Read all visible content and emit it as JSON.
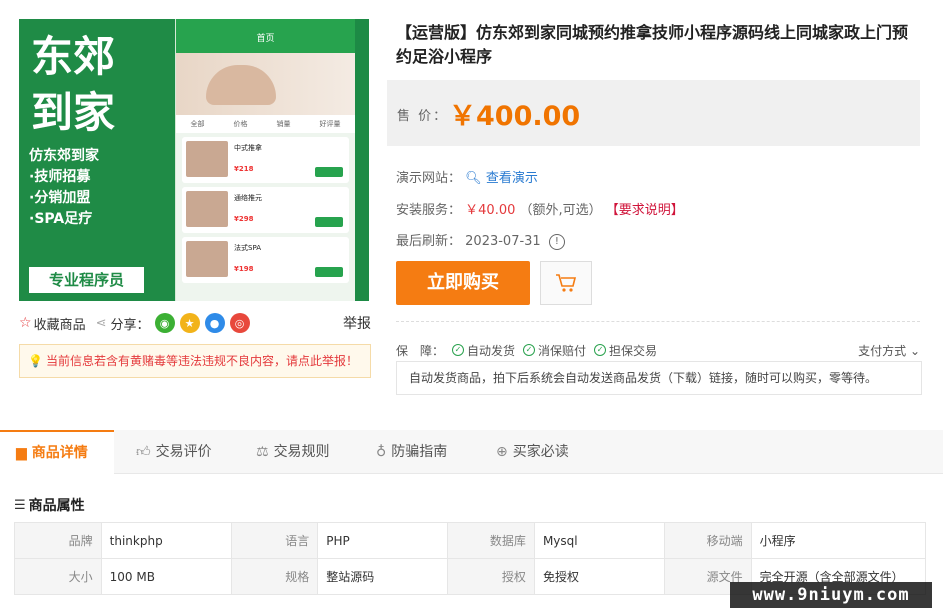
{
  "product_image": {
    "headline": "东郊\n到家",
    "bullets": [
      "仿东郊到家",
      "·技师招募",
      "·分销加盟",
      "·SPA足疗"
    ],
    "badge": "专业程序员",
    "phone": {
      "bar": "首页",
      "tabs": [
        "全部",
        "价格",
        "销量",
        "好评量"
      ],
      "items": [
        {
          "name": "中式推拿",
          "price": "¥218"
        },
        {
          "name": "通络推元",
          "price": "¥298"
        },
        {
          "name": "法式SPA",
          "price": "¥198"
        }
      ]
    }
  },
  "actions": {
    "favorite": "收藏商品",
    "share": "分享：",
    "report": "举报"
  },
  "notice": "当前信息若含有黄赌毒等违法违规不良内容，请点此举报！",
  "title": "【运营版】仿东郊到家同城预约推拿技师小程序源码线上同城家政上门预约足浴小程序",
  "price": {
    "label": "售 价：",
    "value": "￥400.00"
  },
  "demo": {
    "label": "演示网站：",
    "link": "查看演示"
  },
  "install": {
    "label": "安装服务：",
    "price": "￥40.00",
    "note": "（额外,可选）",
    "link": "【要求说明】"
  },
  "refresh": {
    "label": "最后刷新：",
    "date": "2023-07-31"
  },
  "buttons": {
    "buy": "立即购买"
  },
  "guarantee": {
    "label": "保　障：",
    "items": [
      "自动发货",
      "消保赔付",
      "担保交易"
    ],
    "pay": "支付方式",
    "desc": "自动发货商品，拍下后系统会自动发送商品发货（下载）链接，随时可以购买，零等待。"
  },
  "tabs": [
    "商品详情",
    "交易评价",
    "交易规则",
    "防骗指南",
    "买家必读"
  ],
  "attributes": {
    "heading": "商品属性",
    "rows": [
      [
        [
          "品牌",
          "thinkphp"
        ],
        [
          "语言",
          "PHP"
        ],
        [
          "数据库",
          "Mysql"
        ],
        [
          "移动端",
          "小程序"
        ]
      ],
      [
        [
          "大小",
          "100 MB"
        ],
        [
          "规格",
          "整站源码"
        ],
        [
          "授权",
          "免授权"
        ],
        [
          "源文件",
          "完全开源（含全部源文件）"
        ]
      ]
    ]
  },
  "watermark": "www.9niuym.com",
  "colors": {
    "accent": "#f57c12",
    "price": "#f07400",
    "brand_green": "#1f8b46",
    "link_blue": "#2a7bd1",
    "alert_red": "#e4393c"
  }
}
